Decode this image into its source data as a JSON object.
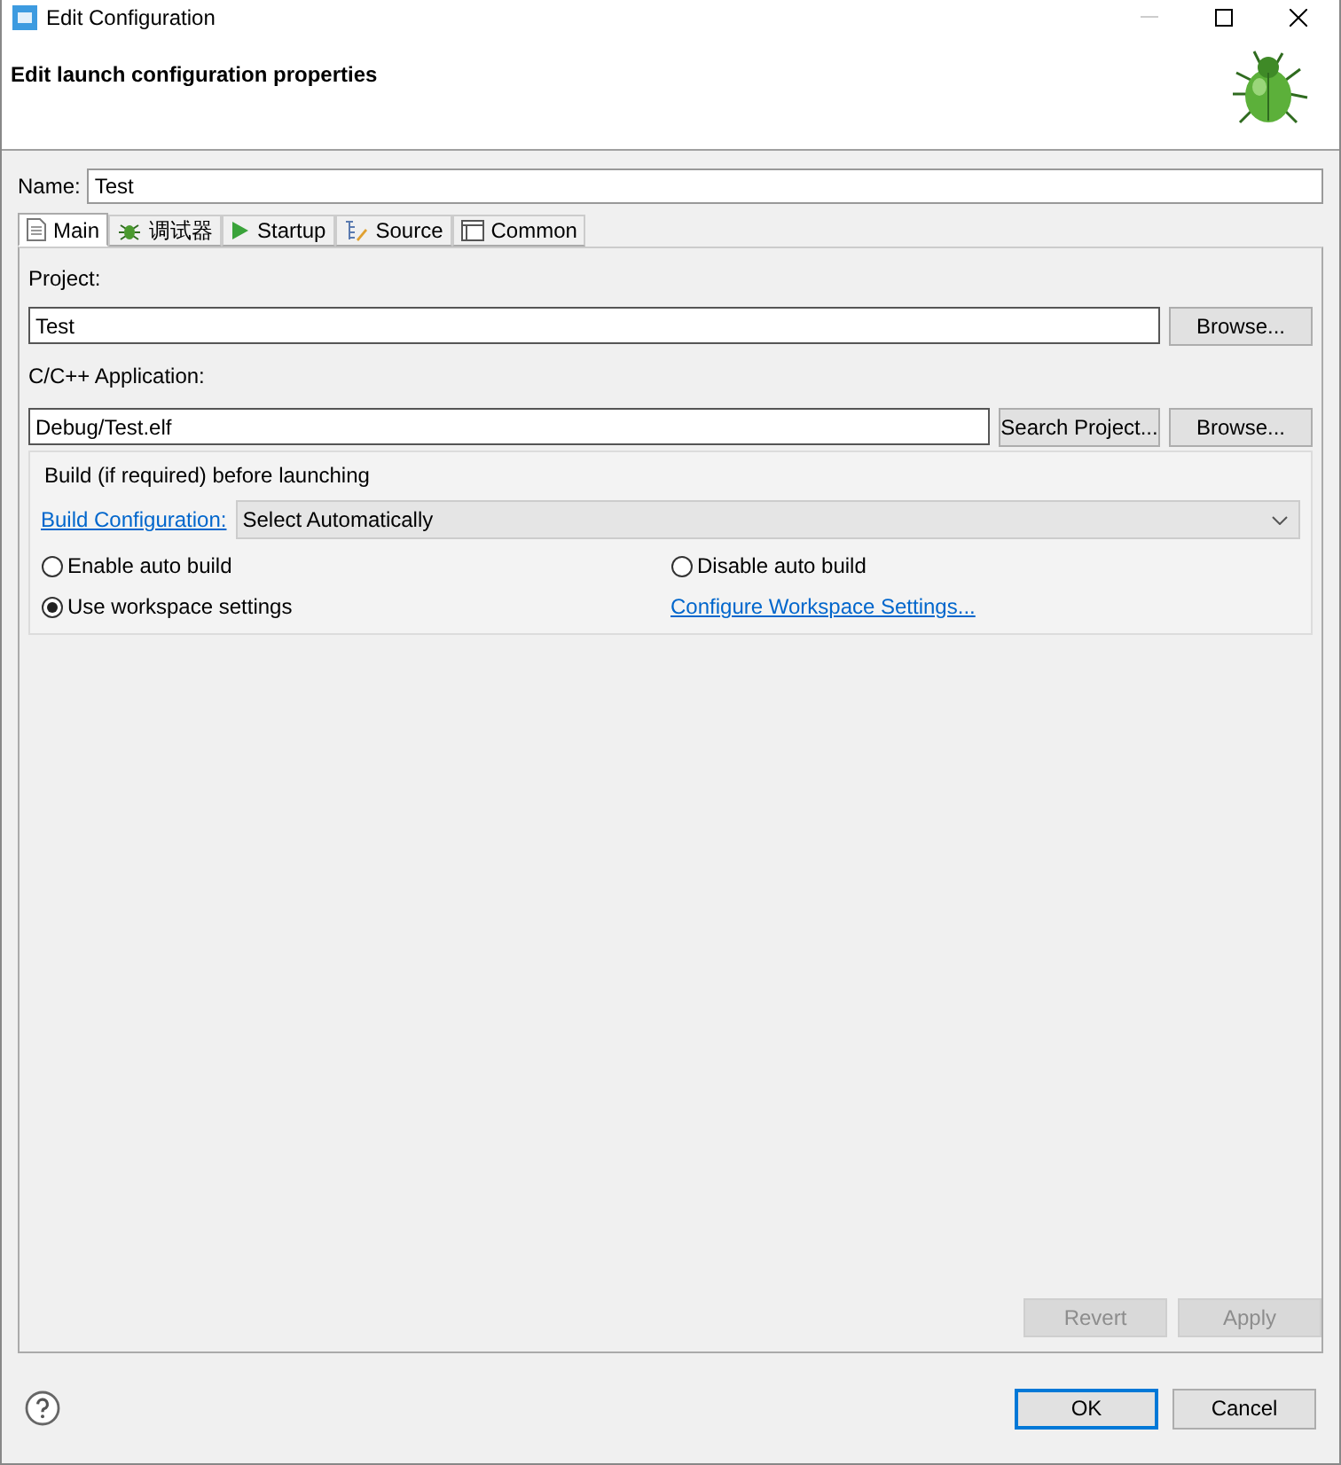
{
  "window": {
    "title": "Edit Configuration"
  },
  "header": {
    "title": "Edit launch configuration properties"
  },
  "name_field": {
    "label": "Name:",
    "value": "Test"
  },
  "tabs": [
    {
      "label": "Main",
      "selected": true
    },
    {
      "label": "调试器",
      "selected": false
    },
    {
      "label": "Startup",
      "selected": false
    },
    {
      "label": "Source",
      "selected": false
    },
    {
      "label": "Common",
      "selected": false
    }
  ],
  "main": {
    "project_label": "Project:",
    "project_value": "Test",
    "project_browse": "Browse...",
    "application_label": "C/C++ Application:",
    "application_value": "Debug/Test.elf",
    "search_button": "Search Project...",
    "application_browse": "Browse...",
    "build_group": {
      "title": "Build (if required) before launching",
      "config_link": "Build Configuration:",
      "config_value": "Select Automatically",
      "options": [
        {
          "label": "Enable auto build",
          "selected": false
        },
        {
          "label": "Disable auto build",
          "selected": false
        },
        {
          "label": "Use workspace settings",
          "selected": true
        }
      ],
      "workspace_link": "Configure Workspace Settings..."
    }
  },
  "panel_buttons": [
    {
      "label": "Revert",
      "disabled": true
    },
    {
      "label": "Apply",
      "disabled": true
    }
  ],
  "dialog_buttons": [
    {
      "label": "OK",
      "default": true
    },
    {
      "label": "Cancel",
      "default": false
    }
  ]
}
